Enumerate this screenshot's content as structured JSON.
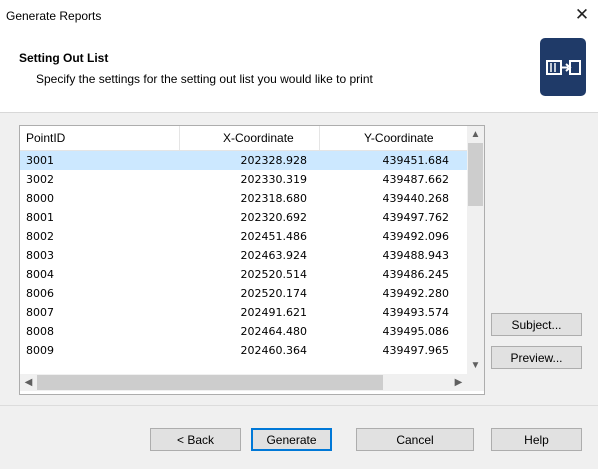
{
  "window": {
    "title": "Generate Reports",
    "close_glyph": "✕"
  },
  "header": {
    "title": "Setting Out List",
    "subtitle": "Specify the settings for the setting out list you would like to print",
    "icon": "wizard-report-icon"
  },
  "table": {
    "columns": [
      "PointID",
      "X-Coordinate",
      "Y-Coordinate"
    ],
    "selected_row": 0,
    "rows": [
      [
        "3001",
        "202328.928",
        "439451.684"
      ],
      [
        "3002",
        "202330.319",
        "439487.662"
      ],
      [
        "8000",
        "202318.680",
        "439440.268"
      ],
      [
        "8001",
        "202320.692",
        "439497.762"
      ],
      [
        "8002",
        "202451.486",
        "439492.096"
      ],
      [
        "8003",
        "202463.924",
        "439488.943"
      ],
      [
        "8004",
        "202520.514",
        "439486.245"
      ],
      [
        "8006",
        "202520.174",
        "439492.280"
      ],
      [
        "8007",
        "202491.621",
        "439493.574"
      ],
      [
        "8008",
        "202464.480",
        "439495.086"
      ],
      [
        "8009",
        "202460.364",
        "439497.965"
      ]
    ]
  },
  "side_buttons": {
    "subject": "Subject...",
    "preview": "Preview..."
  },
  "footer": {
    "back": "< Back",
    "generate": "Generate",
    "cancel": "Cancel",
    "help": "Help"
  },
  "colors": {
    "selection": "#cce8ff",
    "primary_border": "#0078d7",
    "icon_bg": "#1f3a68"
  }
}
